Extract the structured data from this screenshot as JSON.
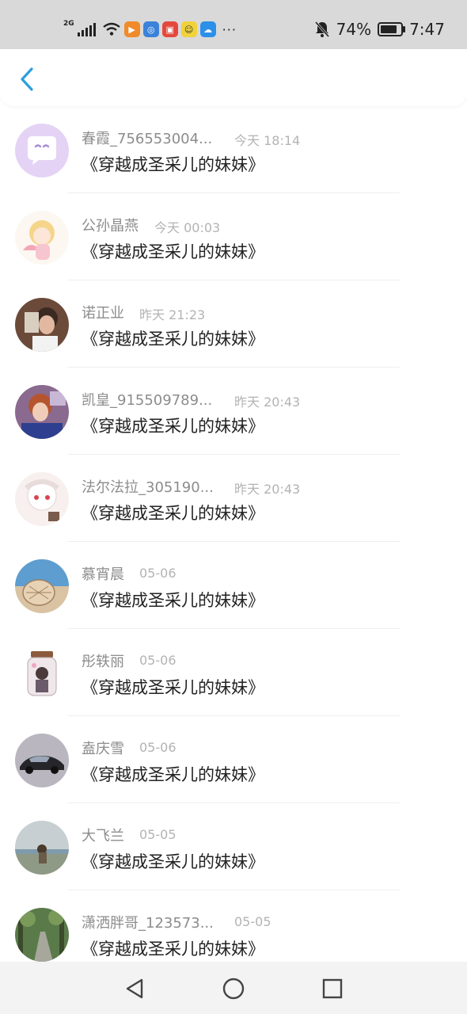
{
  "status_bar": {
    "network": "2G",
    "battery": "74%",
    "time": "7:47",
    "app_icons": [
      "video-app-icon",
      "browser-app-icon",
      "reader-app-icon",
      "baidu-app-icon",
      "cloud-app-icon"
    ],
    "more": "···"
  },
  "header": {
    "back_icon": "chevron-left-icon",
    "accent": "#2a9fe0"
  },
  "messages": [
    {
      "name": "春霞_756553004...",
      "time": "今天 18:14",
      "title": "《穿越成圣采儿的妹妹》",
      "avatar_color": "#e5d3f5"
    },
    {
      "name": "公孙晶燕",
      "time": "今天 00:03",
      "title": "《穿越成圣采儿的妹妹》",
      "avatar_color": "#f6e7d6"
    },
    {
      "name": "诺正业",
      "time": "昨天 21:23",
      "title": "《穿越成圣采儿的妹妹》",
      "avatar_color": "#6b4a3a"
    },
    {
      "name": "凯皇_915509789...",
      "time": "昨天 20:43",
      "title": "《穿越成圣采儿的妹妹》",
      "avatar_color": "#8a6a8f"
    },
    {
      "name": "法尔法拉_305190...",
      "time": "昨天 20:43",
      "title": "《穿越成圣采儿的妹妹》",
      "avatar_color": "#f1e5e2"
    },
    {
      "name": "慕宵晨",
      "time": "05-06",
      "title": "《穿越成圣采儿的妹妹》",
      "avatar_color": "#5d9dcf"
    },
    {
      "name": "彤轶丽",
      "time": "05-06",
      "title": "《穿越成圣采儿的妹妹》",
      "avatar_color": "#e9e2dc"
    },
    {
      "name": "盍庆雪",
      "time": "05-06",
      "title": "《穿越成圣采儿的妹妹》",
      "avatar_color": "#7f7f8a"
    },
    {
      "name": "大飞兰",
      "time": "05-05",
      "title": "《穿越成圣采儿的妹妹》",
      "avatar_color": "#9aa3a6"
    },
    {
      "name": "潇洒胖哥_123573...",
      "time": "05-05",
      "title": "《穿越成圣采儿的妹妹》",
      "avatar_color": "#5a7a4a"
    }
  ],
  "nav_bar": {
    "back": "triangle-back-icon",
    "home": "circle-home-icon",
    "recents": "square-recents-icon"
  }
}
